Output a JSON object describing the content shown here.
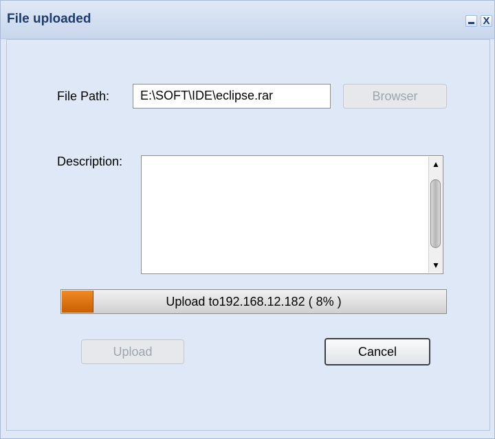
{
  "window": {
    "title": "File uploaded",
    "minimize_icon": "minimize-icon",
    "close_icon": "close-icon",
    "close_glyph": "X"
  },
  "form": {
    "file_path_label": "File Path:",
    "file_path_value": "E:\\SOFT\\IDE\\eclipse.rar",
    "browse_label": "Browser",
    "description_label": "Description:",
    "description_value": ""
  },
  "progress": {
    "text": "Upload to192.168.12.182 ( 8% )",
    "percent": 8,
    "color": "#e07a10"
  },
  "actions": {
    "upload_label": "Upload",
    "cancel_label": "Cancel"
  }
}
